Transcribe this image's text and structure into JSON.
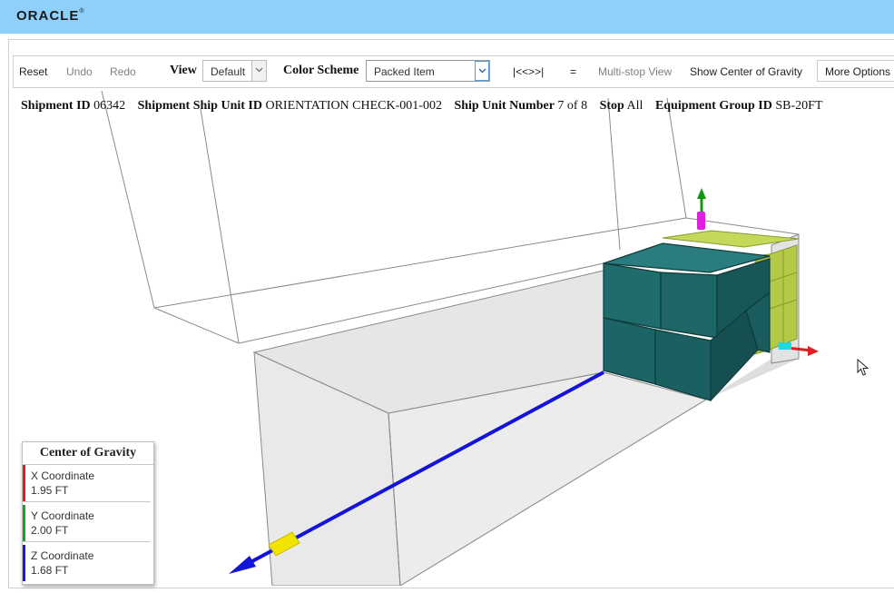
{
  "header": {
    "brand": "ORACLE",
    "brand_mark": "®"
  },
  "toolbar": {
    "reset": "Reset",
    "undo": "Undo",
    "redo": "Redo",
    "view_label": "View",
    "view_value": "Default",
    "color_scheme_label": "Color Scheme",
    "color_scheme_value": "Packed Item",
    "stop_nav": "|<<>>|",
    "equals": "=",
    "multi_stop": "Multi-stop View",
    "show_cog": "Show Center of Gravity",
    "more_options": "More Options"
  },
  "shipment": {
    "shipment_id_label": "Shipment ID",
    "shipment_id": "06342",
    "ship_unit_id_label": "Shipment Ship Unit ID",
    "ship_unit_id": "ORIENTATION CHECK-001-002",
    "ship_unit_number_label": "Ship Unit Number",
    "ship_unit_number": "7 of 8",
    "stop_label": "Stop",
    "stop": "All",
    "equipment_group_label": "Equipment Group ID",
    "equipment_group": "SB-20FT"
  },
  "center_of_gravity": {
    "title": "Center of Gravity",
    "coordinates": [
      {
        "name": "X Coordinate",
        "value": "1.95 FT",
        "color": "#e02020"
      },
      {
        "name": "Y Coordinate",
        "value": "2.00 FT",
        "color": "#20a020"
      },
      {
        "name": "Z Coordinate",
        "value": "1.68 FT",
        "color": "#1a1ad0"
      }
    ]
  },
  "colors": {
    "top_bar": "#8fd0fb",
    "packed_item_teal": "#1c6b6c",
    "packed_item_green": "#b7cc48",
    "axis_x": "#e02020",
    "axis_y": "#149614",
    "axis_z": "#1414d8",
    "cog_marker": "#f0e400"
  }
}
